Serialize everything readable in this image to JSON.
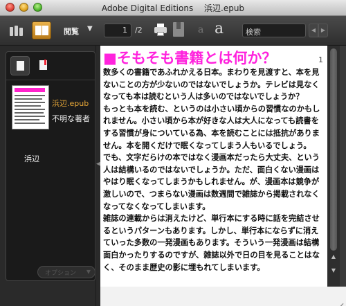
{
  "window": {
    "title": "Adobe Digital Editions　 浜辺.epub"
  },
  "toolbar": {
    "view_label": "閲覧",
    "view_arrow": "▼",
    "current_page": "1",
    "total_pages": "/2",
    "font_small": "a",
    "font_large": "a",
    "search_placeholder": "検索",
    "nav_prev": "◀",
    "nav_next": "▶"
  },
  "sidebar": {
    "book_file": "浜辺.epub",
    "book_author": "不明な著者",
    "toc_item": "浜辺",
    "options_label": "オプション",
    "options_arrow": "▼"
  },
  "page": {
    "number": "1",
    "chapter_title": "■そもそも書籍とは何か？",
    "paragraphs": [
      "数多くの書籍であふれかえる日本。まわりを見渡すと、本を見ないことの方が少ないのではないでしょうか。テレビは見なくなっても本は読むという人は多いのではないでしょうか？",
      "もっとも本を読む、というのは小さい頃からの習慣なのかもしれません。小さい頃から本が好きな人は大人になっても読書をする習慣が身についている為、本を読むことには抵抗がありません。本を開くだけで眠くなってしまう人もいるでしょう。",
      "でも、文字だらけの本ではなく漫画本だったら大丈夫、という人は結構いるのではないでしょうか。ただ、面白くない漫画はやはり眠くなってしまうかもしれません。が、漫画本は競争が激しいので、つまらない漫画は数週間で雑誌から掲載されなくなってなくなってしまいます。",
      "雑誌の連載からは消えたけど、単行本にする時に話を完結させるというパターンもあります。しかし、単行本にならずに消えていった多数の一発漫画もあります。そういう一発漫画は結構面白かったりするのですが、雑誌以外で日の目を見ることはなく、そのまま歴史の影に埋もれてしまいます。"
    ]
  },
  "scrollbar": {
    "up": "▲",
    "down": "▼"
  },
  "colors": {
    "title_magenta": "#ff22dd",
    "book_file_orange": "#e8a838",
    "read_mode_accent": "#d99a30"
  }
}
